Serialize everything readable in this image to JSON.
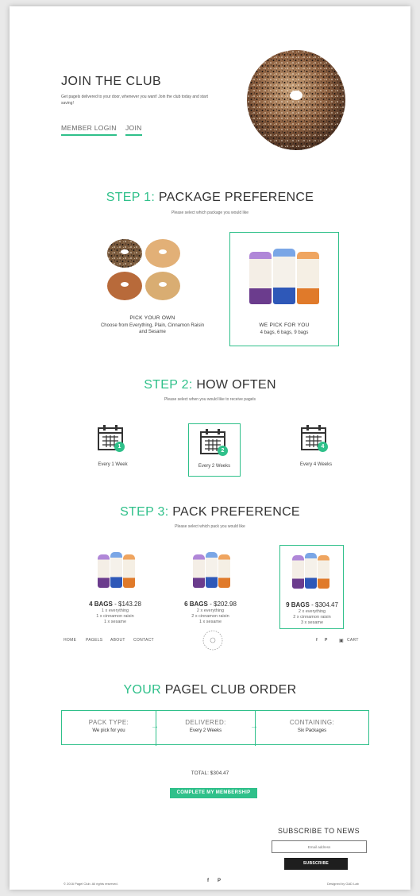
{
  "hero": {
    "title": "JOIN THE CLUB",
    "text": "Get pagels delivered to your door, whenever you want! Join the club today and start saving!",
    "member_login": "MEMBER LOGIN",
    "join": "JOIN"
  },
  "step1": {
    "prefix": "STEP 1:",
    "title": "PACKAGE PREFERENCE",
    "subtitle": "Please select which package you would like",
    "options": [
      {
        "title": "PICK YOUR OWN",
        "desc": "Choose from Everything, Plain, Cinnamon Raisin and Sesame"
      },
      {
        "title": "WE PICK FOR YOU",
        "desc": "4 bags, 6 bags, 9 bags"
      }
    ]
  },
  "step2": {
    "prefix": "STEP 2:",
    "title": "HOW OFTEN",
    "subtitle": "Please select when you would like to receive pagels",
    "options": [
      {
        "num": "1",
        "label": "Every 1 Week"
      },
      {
        "num": "2",
        "label": "Every 2 Weeks"
      },
      {
        "num": "4",
        "label": "Every 4 Weeks"
      }
    ]
  },
  "step3": {
    "prefix": "STEP 3:",
    "title": "PACK PREFERENCE",
    "subtitle": "Please select which pack you would like",
    "packs": [
      {
        "bags": "4 BAGS",
        "price": "- $143.28",
        "lines": [
          "1 x everything",
          "1 x cinnamon raisin",
          "1 x sesame"
        ]
      },
      {
        "bags": "6 BAGS",
        "price": "- $202.98",
        "lines": [
          "2 x everything",
          "2 x cinnamon raisin",
          "1 x sesame"
        ]
      },
      {
        "bags": "9 BAGS",
        "price": "- $304.47",
        "lines": [
          "2 x everything",
          "2 x cinnamon raisin",
          "3 x sesame"
        ]
      }
    ]
  },
  "nav": {
    "home": "HOME",
    "pagels": "PAGELS",
    "about": "ABOUT",
    "contact": "CONTACT",
    "cart": "CART",
    "facebook_icon": "f",
    "pinterest_icon": "P"
  },
  "order": {
    "prefix": "YOUR",
    "title": "PAGEL CLUB ORDER",
    "pack_type_label": "PACK TYPE:",
    "pack_type_value": "We pick for you",
    "delivered_label": "DELIVERED:",
    "delivered_value": "Every 2 Weeks",
    "containing_label": "CONTAINING:",
    "containing_value": "Six Packages",
    "total": "TOTAL: $304.47",
    "complete_button": "COMPLETE MY MEMBERSHIP"
  },
  "subscribe": {
    "title": "SUBSCRIBE TO NEWS",
    "placeholder": "Email address",
    "button": "SUBSCRIBE"
  },
  "footer": {
    "copyright": "© 2016 Pagel Club. All rights reserved.",
    "credit": "Designed by GAD Lab"
  },
  "colors": {
    "accent": "#2fc08a",
    "dark": "#1e1e1e"
  }
}
